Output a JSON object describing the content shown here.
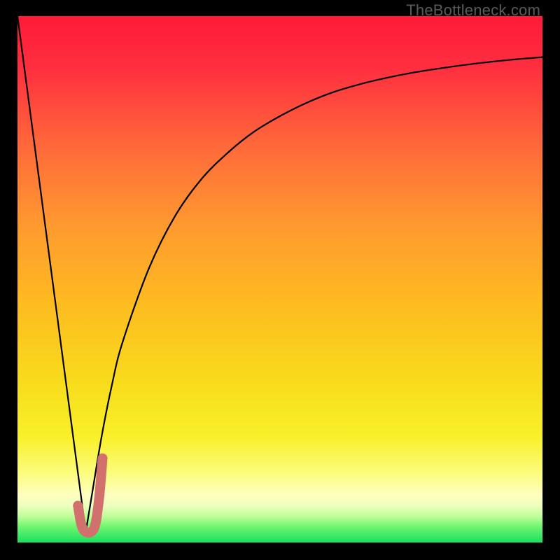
{
  "watermark": "TheBottleneck.com",
  "colors": {
    "frame": "#000000",
    "curve_stroke": "#000000",
    "pink_marker": "#d1706d"
  },
  "chart_data": {
    "type": "line",
    "title": "",
    "xlabel": "",
    "ylabel": "",
    "xlim": [
      0,
      100
    ],
    "ylim": [
      0,
      100
    ],
    "background_gradient": "vertical red→orange→yellow→pale-yellow→green (bottom)",
    "series": [
      {
        "name": "left-descent",
        "x": [
          0,
          13
        ],
        "y": [
          100,
          2
        ]
      },
      {
        "name": "rising-log-curve",
        "x": [
          13,
          14,
          16,
          18,
          20,
          25,
          30,
          35,
          40,
          45,
          50,
          55,
          60,
          65,
          70,
          75,
          80,
          85,
          90,
          95,
          100
        ],
        "y": [
          2,
          8,
          20,
          30,
          38,
          52,
          62,
          69,
          74,
          78,
          81,
          83.5,
          85.5,
          87,
          88.2,
          89.2,
          90,
          90.7,
          91.3,
          91.8,
          92.2
        ]
      },
      {
        "name": "pink-hook-marker",
        "x": [
          11.5,
          12.5,
          14.5,
          15.5,
          16.2
        ],
        "y": [
          7,
          2.5,
          2.5,
          8,
          16
        ]
      }
    ]
  }
}
